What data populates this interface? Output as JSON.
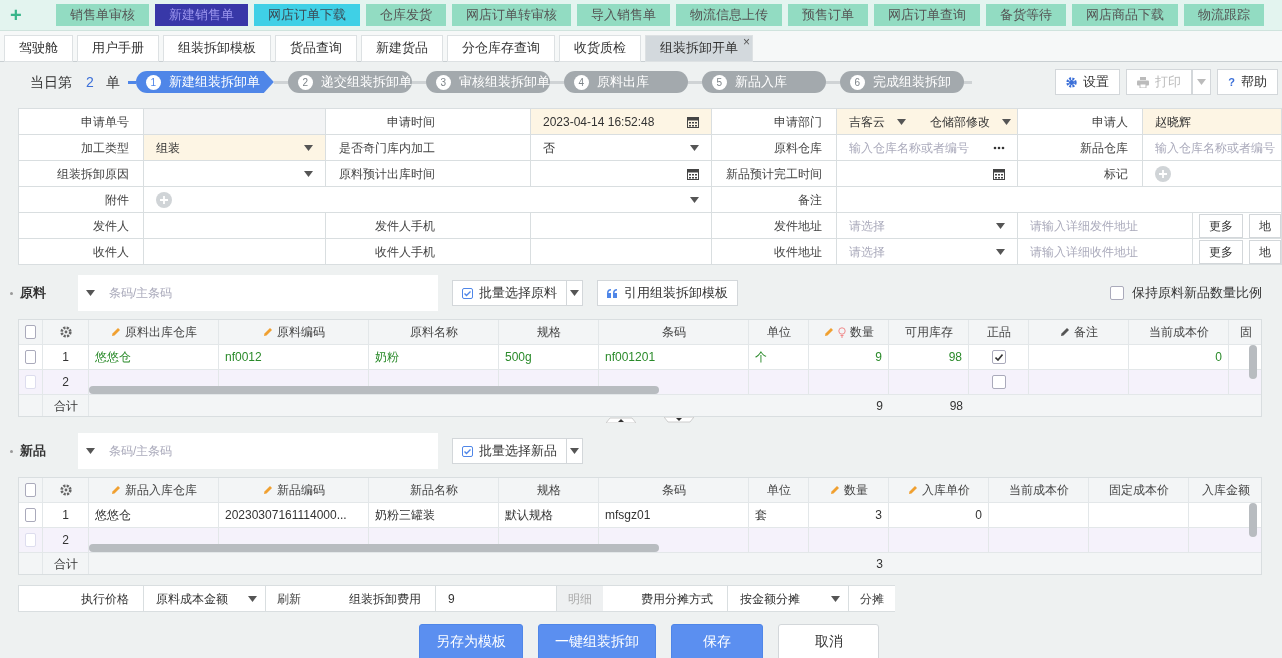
{
  "quick_add": "+",
  "top_buttons": [
    {
      "label": "销售单审核",
      "kind": "normal"
    },
    {
      "label": "新建销售单",
      "kind": "active"
    },
    {
      "label": "网店订单下载",
      "kind": "focused"
    },
    {
      "label": "仓库发货",
      "kind": "normal"
    },
    {
      "label": "网店订单转审核",
      "kind": "normal"
    },
    {
      "label": "导入销售单",
      "kind": "normal"
    },
    {
      "label": "物流信息上传",
      "kind": "normal"
    },
    {
      "label": "预售订单",
      "kind": "normal"
    },
    {
      "label": "网店订单查询",
      "kind": "normal"
    },
    {
      "label": "备货等待",
      "kind": "normal"
    },
    {
      "label": "网店商品下载",
      "kind": "normal"
    },
    {
      "label": "物流跟踪",
      "kind": "normal"
    }
  ],
  "tabs": [
    {
      "label": "驾驶舱",
      "selected": false
    },
    {
      "label": "用户手册",
      "selected": false
    },
    {
      "label": "组装拆卸模板",
      "selected": false
    },
    {
      "label": "货品查询",
      "selected": false
    },
    {
      "label": "新建货品",
      "selected": false
    },
    {
      "label": "分仓库存查询",
      "selected": false
    },
    {
      "label": "收货质检",
      "selected": false
    },
    {
      "label": "组装拆卸开单",
      "selected": true,
      "close": "×"
    }
  ],
  "daily_count": {
    "prefix": "当日第",
    "count": "2",
    "suffix": "单"
  },
  "steps": [
    {
      "number": "1",
      "label": "新建组装拆卸单",
      "selected": true
    },
    {
      "number": "2",
      "label": "递交组装拆卸单",
      "selected": false
    },
    {
      "number": "3",
      "label": "审核组装拆卸单",
      "selected": false
    },
    {
      "number": "4",
      "label": "原料出库",
      "selected": false
    },
    {
      "number": "5",
      "label": "新品入库",
      "selected": false
    },
    {
      "number": "6",
      "label": "完成组装拆卸",
      "selected": false
    }
  ],
  "toolbar": [
    {
      "label": "设置",
      "kind": "settings",
      "disabled": false
    },
    {
      "label": "打印",
      "kind": "print",
      "disabled": true
    },
    {
      "label": "帮助",
      "kind": "help",
      "icon": "?",
      "disabled": false
    }
  ],
  "form": [
    [
      {
        "kind": "label",
        "text": "申请单号"
      },
      {
        "kind": "input",
        "disabled": true
      },
      {
        "kind": "label",
        "text": "申请时间"
      },
      {
        "kind": "date",
        "value": "2023-04-14 16:52:48",
        "required": true
      },
      {
        "kind": "label",
        "text": "申请部门"
      },
      {
        "kind": "double_select",
        "values": [
          "吉客云",
          "仓储部修改"
        ],
        "required": true
      },
      {
        "kind": "label",
        "text": "申请人"
      },
      {
        "kind": "input",
        "value": "赵晓辉",
        "required": true
      }
    ],
    [
      {
        "kind": "label",
        "text": "加工类型"
      },
      {
        "kind": "select",
        "value": "组装",
        "required": true
      },
      {
        "kind": "label",
        "text": "是否奇门库内加工"
      },
      {
        "kind": "select",
        "value": "否"
      },
      {
        "kind": "label",
        "text": "原料仓库"
      },
      {
        "kind": "lookup",
        "placeholder": "输入仓库名称或者编号"
      },
      {
        "kind": "label",
        "text": "新品仓库"
      },
      {
        "kind": "input",
        "placeholder": "输入仓库名称或者编号"
      }
    ],
    [
      {
        "kind": "label",
        "text": "组装拆卸原因"
      },
      {
        "kind": "select"
      },
      {
        "kind": "label",
        "text": "原料预计出库时间"
      },
      {
        "kind": "date"
      },
      {
        "kind": "label",
        "text": "新品预计完工时间"
      },
      {
        "kind": "date"
      },
      {
        "kind": "label",
        "text": "标记"
      },
      {
        "kind": "tag"
      }
    ],
    [
      {
        "kind": "label",
        "text": "附件"
      },
      {
        "kind": "attachment"
      },
      {
        "kind": "label",
        "text": "备注"
      },
      {
        "kind": "wide_input"
      }
    ],
    [
      {
        "kind": "label",
        "text": "发件人"
      },
      {
        "kind": "input"
      },
      {
        "kind": "label",
        "text": "发件人手机"
      },
      {
        "kind": "input"
      },
      {
        "kind": "label",
        "text": "发件地址"
      },
      {
        "kind": "select",
        "placeholder": "请选择"
      },
      {
        "kind": "address",
        "placeholder": "请输入详细发件地址",
        "buttons": [
          "更多",
          "地"
        ]
      }
    ],
    [
      {
        "kind": "label",
        "text": "收件人"
      },
      {
        "kind": "input"
      },
      {
        "kind": "label",
        "text": "收件人手机"
      },
      {
        "kind": "input"
      },
      {
        "kind": "label",
        "text": "收件地址"
      },
      {
        "kind": "select",
        "placeholder": "请选择"
      },
      {
        "kind": "address",
        "placeholder": "请输入详细收件地址",
        "buttons": [
          "更多",
          "地"
        ]
      }
    ]
  ],
  "sections": [
    {
      "title": "原料",
      "search_placeholder": "条码/主条码",
      "buttons": [
        {
          "label": "批量选择原料",
          "kind": "batch",
          "dropdown": true
        },
        {
          "label": "引用组装拆卸模板",
          "kind": "template",
          "dropdown": false
        }
      ],
      "keep_ratio": {
        "label": "保持原料新品数量比例",
        "checked": false
      },
      "table": {
        "total_label": "合计",
        "highlight": true,
        "all_selected": false,
        "columns": [
          {
            "label": "原料出库仓库",
            "editable": true
          },
          {
            "label": "原料编码",
            "editable": true
          },
          {
            "label": "原料名称"
          },
          {
            "label": "规格"
          },
          {
            "label": "条码"
          },
          {
            "label": "单位"
          },
          {
            "label": "数量",
            "editable": true,
            "hint": true,
            "numeric": true,
            "total": "9"
          },
          {
            "label": "可用库存",
            "numeric": true,
            "total": "98"
          },
          {
            "label": "正品",
            "kind": "check"
          },
          {
            "label": "备注",
            "editable": true,
            "dark_edit": true
          },
          {
            "label": "当前成本价",
            "numeric": true
          },
          {
            "label": "固"
          }
        ],
        "rows": [
          {
            "index": "1",
            "selected": false,
            "kind": "item",
            "cells": [
              {
                "text": "悠悠仓"
              },
              {
                "text": "nf0012"
              },
              {
                "text": "奶粉"
              },
              {
                "text": "500g"
              },
              {
                "text": "nf001201"
              },
              {
                "text": "个"
              },
              {
                "text": "9"
              },
              {
                "text": "98"
              },
              {
                "checked": true
              },
              {},
              {
                "text": "0"
              },
              {}
            ]
          },
          {
            "index": "2",
            "selected": false,
            "kind": "new",
            "cells": [
              {},
              {},
              {},
              {},
              {},
              {},
              {},
              {},
              {
                "checked": false
              },
              {},
              {},
              {}
            ]
          }
        ]
      }
    },
    {
      "title": "新品",
      "search_placeholder": "条码/主条码",
      "buttons": [
        {
          "label": "批量选择新品",
          "kind": "batch",
          "dropdown": true
        }
      ],
      "table": {
        "total_label": "合计",
        "highlight": false,
        "all_selected": false,
        "columns": [
          {
            "label": "新品入库仓库",
            "editable": true
          },
          {
            "label": "新品编码",
            "editable": true
          },
          {
            "label": "新品名称"
          },
          {
            "label": "规格"
          },
          {
            "label": "条码"
          },
          {
            "label": "单位"
          },
          {
            "label": "数量",
            "editable": true,
            "numeric": true,
            "total": "3"
          },
          {
            "label": "入库单价",
            "editable": true,
            "numeric": true
          },
          {
            "label": "当前成本价"
          },
          {
            "label": "固定成本价"
          },
          {
            "label": "入库金额"
          }
        ],
        "rows": [
          {
            "index": "1",
            "selected": false,
            "kind": "item",
            "cells": [
              {
                "text": "悠悠仓"
              },
              {
                "text": "20230307161114000..."
              },
              {
                "text": "奶粉三罐装"
              },
              {
                "text": "默认规格"
              },
              {
                "text": "mfsgz01"
              },
              {
                "text": "套"
              },
              {
                "text": "3"
              },
              {
                "text": "0"
              },
              {},
              {},
              {}
            ]
          },
          {
            "index": "2",
            "selected": false,
            "kind": "new",
            "cells": [
              {},
              {},
              {},
              {},
              {},
              {},
              {},
              {},
              {},
              {},
              {}
            ]
          }
        ]
      }
    }
  ],
  "cost_row": [
    {
      "kind": "label",
      "text": "执行价格"
    },
    {
      "kind": "select",
      "value": "原料成本金额"
    },
    {
      "kind": "button",
      "text": "刷新",
      "disabled": false
    },
    {
      "kind": "label",
      "text": "组装拆卸费用"
    },
    {
      "kind": "input",
      "value": "9"
    },
    {
      "kind": "button",
      "text": "明细",
      "disabled": true
    },
    {
      "kind": "label",
      "text": "费用分摊方式"
    },
    {
      "kind": "select",
      "value": "按金额分摊"
    },
    {
      "kind": "button",
      "text": "分摊",
      "disabled": false
    }
  ],
  "actions": [
    {
      "label": "另存为模板",
      "kind": "primary"
    },
    {
      "label": "一键组装拆卸",
      "kind": "primary"
    },
    {
      "label": "保存",
      "kind": "primary"
    },
    {
      "label": "取消",
      "kind": "secondary"
    }
  ]
}
